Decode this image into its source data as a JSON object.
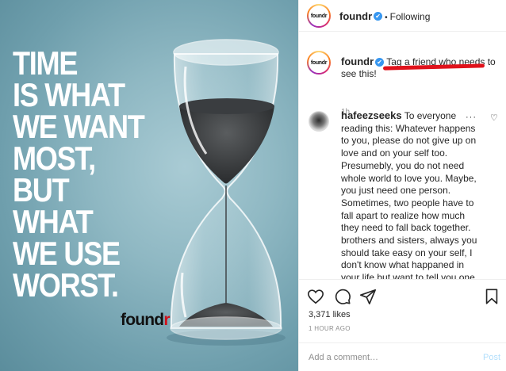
{
  "post_image": {
    "headline_lines": [
      "TIME",
      "IS WHAT",
      "WE WANT",
      "MOST,",
      "BUT",
      "WHAT",
      "WE USE",
      "WORST."
    ],
    "brand_main": "found",
    "brand_accent": "r",
    "colors": {
      "background": "#8fb8c3",
      "headline": "#ffffff",
      "brand_accent": "#d0121b"
    }
  },
  "header": {
    "avatar_text": "foundr",
    "username": "foundr",
    "verified_glyph": "✔",
    "separator": "•",
    "follow_label": "Following"
  },
  "caption": {
    "avatar_text": "foundr",
    "username": "foundr",
    "verified_glyph": "✔",
    "text": "Tag a friend who needs to see this!",
    "time": "1h"
  },
  "comment": {
    "username": "hafeezseeks",
    "text": "To everyone reading this: Whatever happens to you, please do not give up on love and on your self too. Presumebly, you do not need whole world to love you. Maybe, you just need one person. Sometimes, two people have to fall apart to realize how much they need to fall back together. brothers and sisters, always you should take easy on your self, I don't know what happaned in your life but want to tell you one thing, life is a very",
    "options_glyph": "···",
    "like_glyph": "♡"
  },
  "actions": {
    "icons": [
      "heart-icon",
      "comment-icon",
      "share-icon",
      "bookmark-icon"
    ]
  },
  "likes": "3,371 likes",
  "timestamp": "1 HOUR AGO",
  "add_comment": {
    "placeholder": "Add a comment…",
    "post_label": "Post"
  }
}
